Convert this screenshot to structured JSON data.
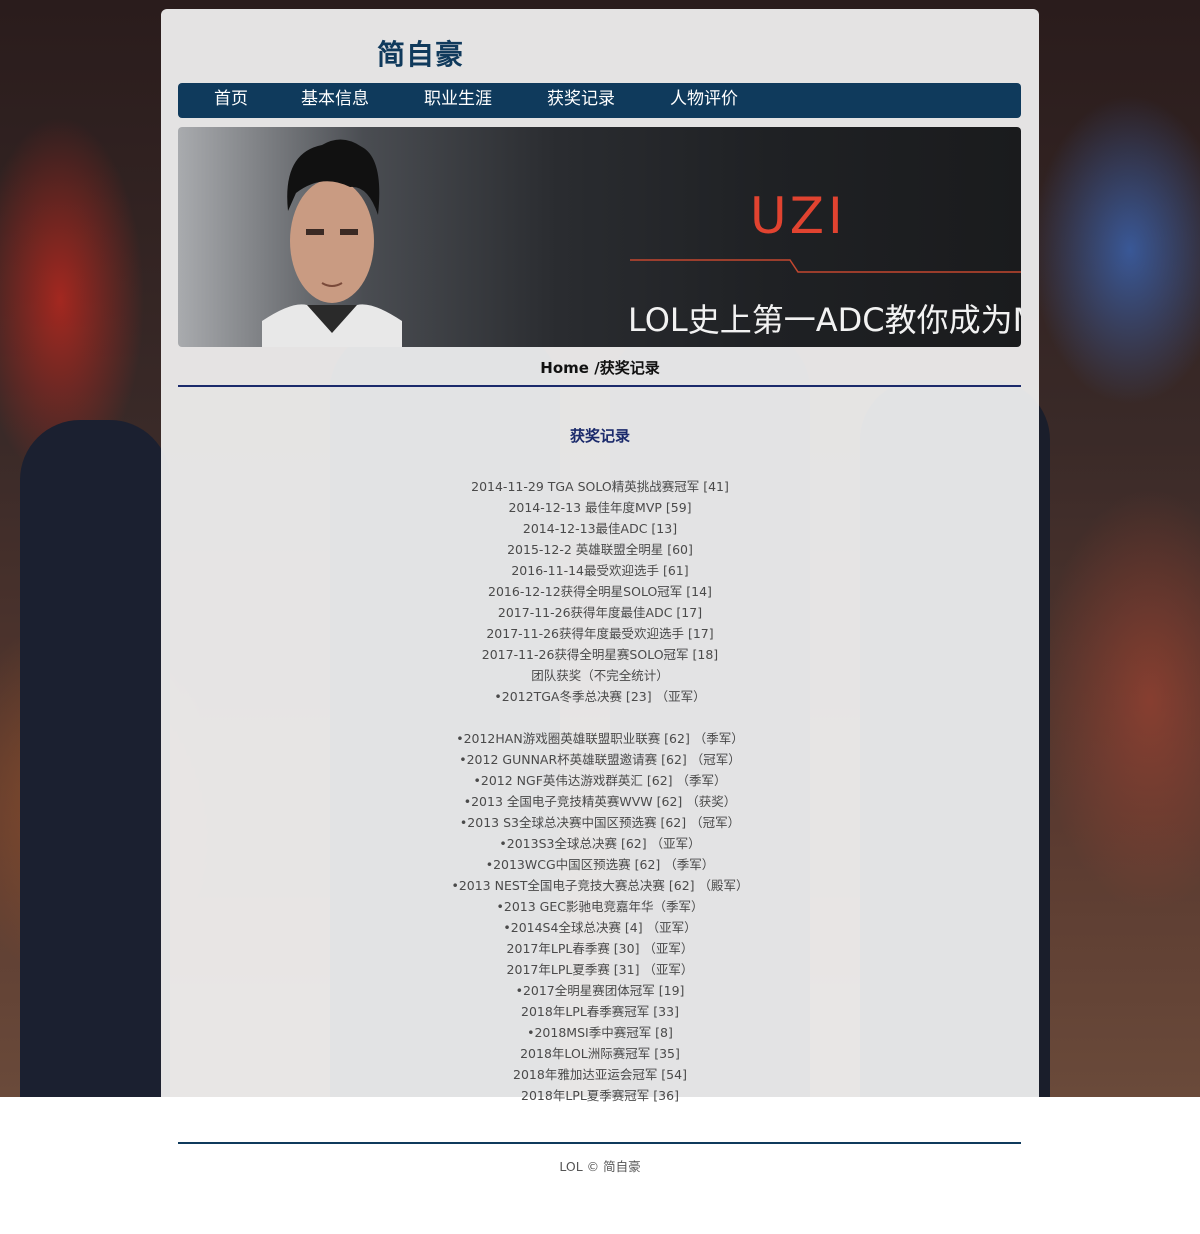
{
  "site": {
    "title": "简自豪"
  },
  "nav": {
    "items": [
      {
        "label": "首页"
      },
      {
        "label": "基本信息"
      },
      {
        "label": "职业生涯"
      },
      {
        "label": "获奖记录"
      },
      {
        "label": "人物评价"
      }
    ]
  },
  "banner": {
    "name": "UZI",
    "tagline": "LOL史上第一ADC教你成为M"
  },
  "breadcrumb": {
    "home": "Home",
    "separator": "/",
    "current": "获奖记录"
  },
  "section": {
    "title": "获奖记录"
  },
  "records": [
    "2014-11-29 TGA SOLO精英挑战赛冠军 [41]",
    "2014-12-13 最佳年度MVP [59]",
    "2014-12-13最佳ADC [13]",
    "2015-12-2 英雄联盟全明星 [60]",
    "2016-11-14最受欢迎选手 [61]",
    "2016-12-12获得全明星SOLO冠军 [14]",
    "2017-11-26获得年度最佳ADC [17]",
    "2017-11-26获得年度最受欢迎选手 [17]",
    "2017-11-26获得全明星赛SOLO冠军 [18]",
    "团队获奖（不完全统计）",
    "•2012TGA冬季总决赛 [23] （亚军）",
    "",
    "•2012HAN游戏圈英雄联盟职业联赛 [62] （季军）",
    "•2012 GUNNAR杯英雄联盟邀请赛 [62] （冠军）",
    "•2012 NGF英伟达游戏群英汇 [62] （季军）",
    "•2013 全国电子竞技精英赛WVW [62] （获奖）",
    "•2013 S3全球总决赛中国区预选赛 [62] （冠军）",
    "•2013S3全球总决赛 [62] （亚军）",
    "•2013WCG中国区预选赛 [62] （季军）",
    "•2013 NEST全国电子竞技大赛总决赛 [62] （殿军）",
    "•2013 GEC影驰电竞嘉年华（季军）",
    "•2014S4全球总决赛 [4] （亚军）",
    "2017年LPL春季赛 [30] （亚军）",
    "2017年LPL夏季赛 [31] （亚军）",
    "•2017全明星赛团体冠军 [19]",
    "2018年LPL春季赛冠军 [33]",
    "•2018MSI季中赛冠军 [8]",
    "2018年LOL洲际赛冠军 [35]",
    "2018年雅加达亚运会冠军 [54]",
    "2018年LPL夏季赛冠军 [36]"
  ],
  "footer": {
    "text": "LOL © 简自豪"
  },
  "colors": {
    "nav": "#0f3a5c",
    "accent": "#1b2a6b",
    "banner_name": "#e14330"
  }
}
